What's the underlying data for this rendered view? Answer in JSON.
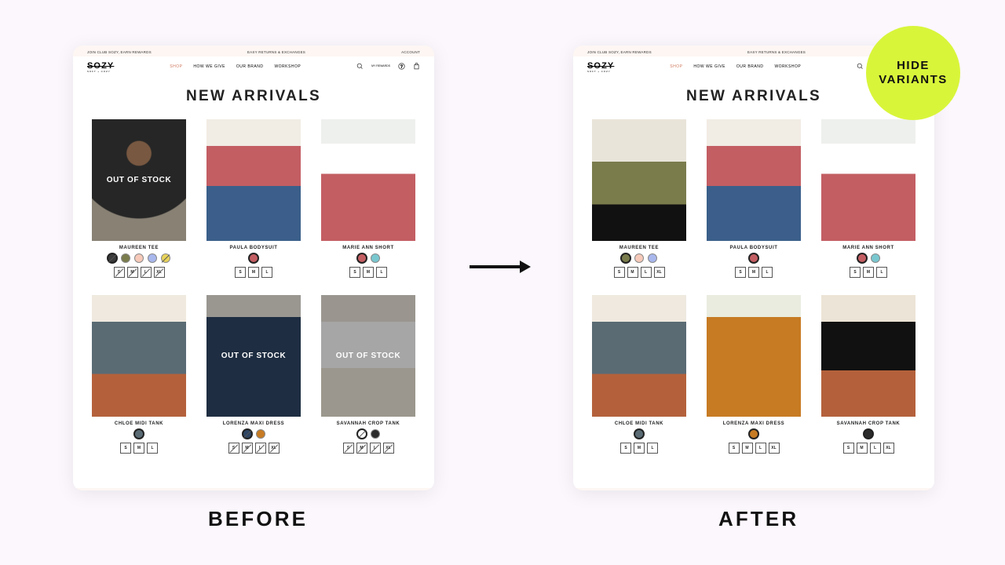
{
  "badge": {
    "line1": "HIDE",
    "line2": "VARIANTS"
  },
  "captions": {
    "before": "BEFORE",
    "after": "AFTER"
  },
  "topbar": {
    "left": "JOIN CLUB SOZY, EARN REWARDS",
    "center": "EASY RETURNS & EXCHANGES",
    "right": "ACCOUNT"
  },
  "nav": {
    "logo": "SOZY",
    "logo_sub": "SOFT + COZY",
    "links": [
      "SHOP",
      "HOW WE GIVE",
      "OUR BRAND",
      "WORKSHOP"
    ],
    "icon_rewards": "MY REWARDS"
  },
  "page_title": "NEW ARRIVALS",
  "out_of_stock_label": "OUT OF STOCK",
  "before": {
    "products": [
      {
        "name": "MAUREEN TEE",
        "img": "p-maureen-dark",
        "out_of_stock": true,
        "swatches": [
          {
            "color": "#3b3b3b",
            "sel": true,
            "struck": true
          },
          {
            "color": "#7a7c4c"
          },
          {
            "color": "#f6c9b9"
          },
          {
            "color": "#a8b7ec"
          },
          {
            "color": "#e8d35a",
            "struck": true
          }
        ],
        "sizes": [
          {
            "s": "S",
            "struck": true
          },
          {
            "s": "M",
            "struck": true
          },
          {
            "s": "L",
            "struck": true
          },
          {
            "s": "XL",
            "struck": true
          }
        ]
      },
      {
        "name": "PAULA BODYSUIT",
        "img": "p-paula",
        "swatches": [
          {
            "color": "#c35e63",
            "sel": true
          }
        ],
        "sizes": [
          {
            "s": "S",
            "sel": true
          },
          {
            "s": "M"
          },
          {
            "s": "L"
          }
        ]
      },
      {
        "name": "MARIE ANN SHORT",
        "img": "p-marie",
        "swatches": [
          {
            "color": "#c35e63",
            "sel": true
          },
          {
            "color": "#79c7cf"
          }
        ],
        "sizes": [
          {
            "s": "S",
            "sel": true
          },
          {
            "s": "M"
          },
          {
            "s": "L"
          }
        ]
      },
      {
        "name": "CHLOE MIDI TANK",
        "img": "p-chloe",
        "swatches": [
          {
            "color": "#5a6b74",
            "sel": true
          }
        ],
        "sizes": [
          {
            "s": "S",
            "sel": true
          },
          {
            "s": "M"
          },
          {
            "s": "L"
          }
        ]
      },
      {
        "name": "LORENZA MAXI DRESS",
        "img": "p-lorenza-blue",
        "out_of_stock": true,
        "swatches": [
          {
            "color": "#2f4664",
            "sel": true,
            "struck": true
          },
          {
            "color": "#c77b23"
          }
        ],
        "sizes": [
          {
            "s": "S",
            "struck": true
          },
          {
            "s": "M",
            "struck": true
          },
          {
            "s": "L",
            "struck": true
          },
          {
            "s": "XL",
            "struck": true
          }
        ]
      },
      {
        "name": "SAVANNAH CROP TANK",
        "img": "p-savannah-white",
        "out_of_stock": true,
        "swatches": [
          {
            "color": "#ffffff",
            "sel": true,
            "struck": true
          },
          {
            "color": "#2b2b2b"
          }
        ],
        "sizes": [
          {
            "s": "S",
            "struck": true
          },
          {
            "s": "M",
            "struck": true
          },
          {
            "s": "L",
            "struck": true
          },
          {
            "s": "XL",
            "struck": true
          }
        ]
      }
    ]
  },
  "after": {
    "products": [
      {
        "name": "MAUREEN TEE",
        "img": "p-maureen-olive",
        "swatches": [
          {
            "color": "#7a7c4c",
            "sel": true
          },
          {
            "color": "#f6c9b9"
          },
          {
            "color": "#a8b7ec"
          }
        ],
        "sizes": [
          {
            "s": "S",
            "sel": true
          },
          {
            "s": "M"
          },
          {
            "s": "L"
          },
          {
            "s": "XL"
          }
        ]
      },
      {
        "name": "PAULA BODYSUIT",
        "img": "p-paula",
        "swatches": [
          {
            "color": "#c35e63",
            "sel": true
          }
        ],
        "sizes": [
          {
            "s": "S",
            "sel": true
          },
          {
            "s": "M"
          },
          {
            "s": "L"
          }
        ]
      },
      {
        "name": "MARIE ANN SHORT",
        "img": "p-marie",
        "swatches": [
          {
            "color": "#c35e63",
            "sel": true
          },
          {
            "color": "#79c7cf"
          }
        ],
        "sizes": [
          {
            "s": "S",
            "sel": true
          },
          {
            "s": "M"
          },
          {
            "s": "L"
          }
        ]
      },
      {
        "name": "CHLOE MIDI TANK",
        "img": "p-chloe",
        "swatches": [
          {
            "color": "#5a6b74",
            "sel": true
          }
        ],
        "sizes": [
          {
            "s": "S",
            "sel": true
          },
          {
            "s": "M"
          },
          {
            "s": "L"
          }
        ]
      },
      {
        "name": "LORENZA MAXI DRESS",
        "img": "p-lorenza-orange",
        "swatches": [
          {
            "color": "#c77b23",
            "sel": true
          }
        ],
        "sizes": [
          {
            "s": "S",
            "sel": true
          },
          {
            "s": "M"
          },
          {
            "s": "L"
          },
          {
            "s": "XL"
          }
        ]
      },
      {
        "name": "SAVANNAH CROP TANK",
        "img": "p-savannah-black",
        "swatches": [
          {
            "color": "#2b2b2b",
            "sel": true
          }
        ],
        "sizes": [
          {
            "s": "S",
            "sel": true
          },
          {
            "s": "M"
          },
          {
            "s": "L"
          },
          {
            "s": "XL"
          }
        ]
      }
    ]
  }
}
